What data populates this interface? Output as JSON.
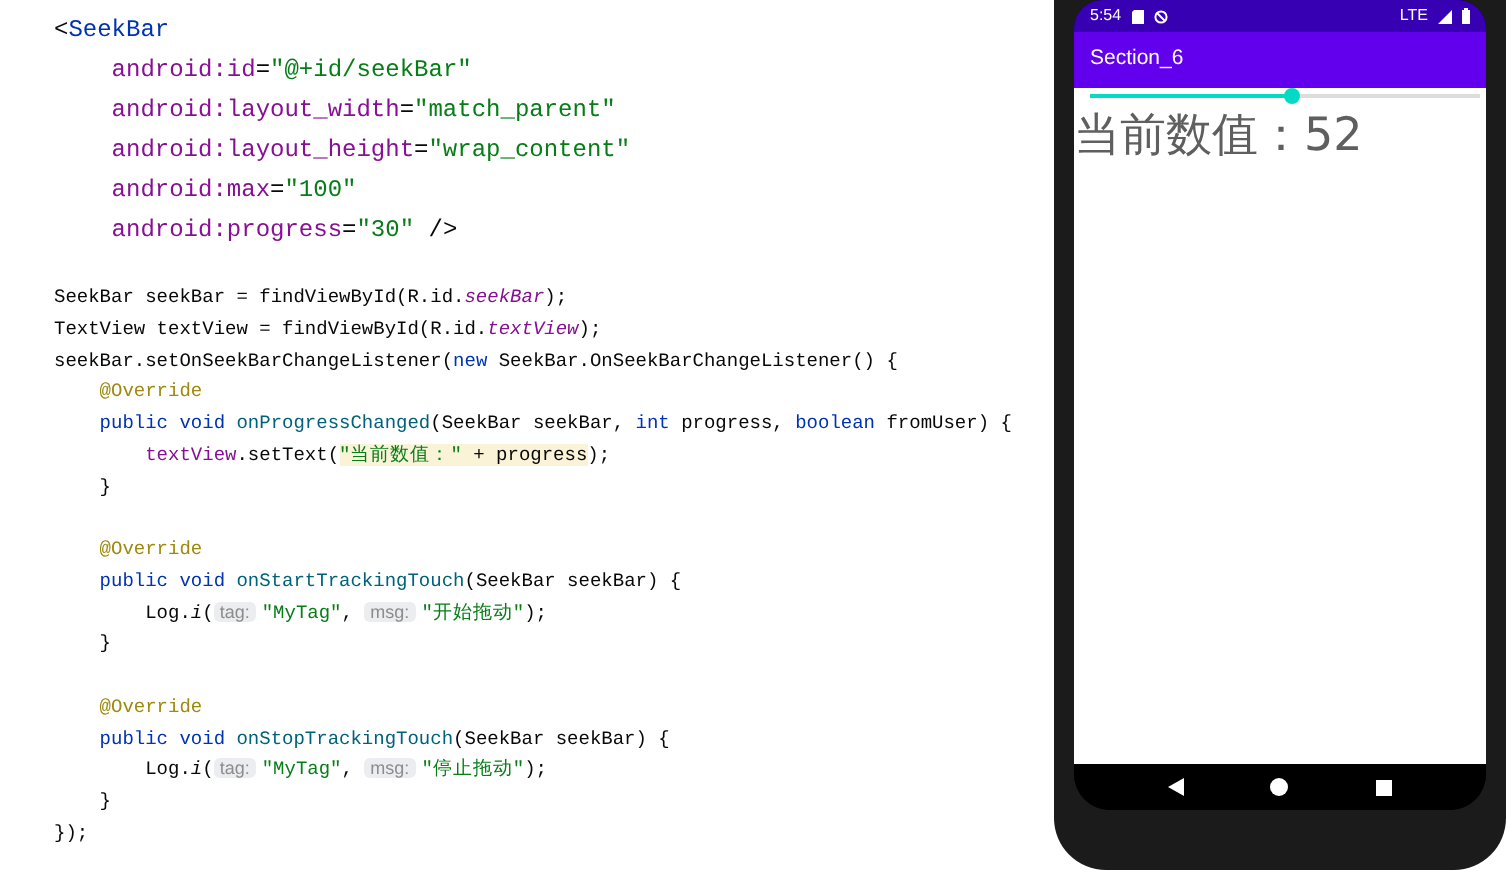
{
  "xml_code": {
    "lines": [
      {
        "kind": "code",
        "tokens": [
          {
            "kind": "plain",
            "text": "<"
          },
          {
            "kind": "tag",
            "text": "SeekBar"
          }
        ]
      },
      {
        "kind": "code",
        "tokens": [
          {
            "kind": "attr",
            "text": "    android:id"
          },
          {
            "kind": "plain",
            "text": "="
          },
          {
            "kind": "string",
            "text": "\"@+id/seekBar\""
          }
        ]
      },
      {
        "kind": "code",
        "tokens": [
          {
            "kind": "attr",
            "text": "    android:layout_width"
          },
          {
            "kind": "plain",
            "text": "="
          },
          {
            "kind": "string",
            "text": "\"match_parent\""
          }
        ]
      },
      {
        "kind": "code",
        "tokens": [
          {
            "kind": "attr",
            "text": "    android:layout_height"
          },
          {
            "kind": "plain",
            "text": "="
          },
          {
            "kind": "string",
            "text": "\"wrap_content\""
          }
        ]
      },
      {
        "kind": "code",
        "tokens": [
          {
            "kind": "attr",
            "text": "    android:max"
          },
          {
            "kind": "plain",
            "text": "="
          },
          {
            "kind": "string",
            "text": "\"100\""
          }
        ]
      },
      {
        "kind": "code",
        "tokens": [
          {
            "kind": "attr",
            "text": "    android:progress"
          },
          {
            "kind": "plain",
            "text": "="
          },
          {
            "kind": "string",
            "text": "\"30\""
          },
          {
            "kind": "plain",
            "text": " />"
          }
        ]
      }
    ]
  },
  "java_code": {
    "lines": [
      {
        "kind": "code",
        "tokens": [
          {
            "kind": "plain",
            "text": "SeekBar seekBar = findViewById(R.id."
          },
          {
            "kind": "field",
            "text": "seekBar"
          },
          {
            "kind": "plain",
            "text": ");"
          }
        ]
      },
      {
        "kind": "code",
        "tokens": [
          {
            "kind": "plain",
            "text": "TextView textView = findViewById(R.id."
          },
          {
            "kind": "field",
            "text": "textView"
          },
          {
            "kind": "plain",
            "text": ");"
          }
        ]
      },
      {
        "kind": "code",
        "tokens": [
          {
            "kind": "plain",
            "text": "seekBar.setOnSeekBarChangeListener("
          },
          {
            "kind": "keyword",
            "text": "new"
          },
          {
            "kind": "plain",
            "text": " SeekBar.OnSeekBarChangeListener() {"
          }
        ]
      },
      {
        "kind": "code",
        "tokens": [
          {
            "kind": "annotation",
            "text": "    @Override"
          }
        ]
      },
      {
        "kind": "code",
        "tokens": [
          {
            "kind": "keyword",
            "text": "    public void "
          },
          {
            "kind": "method",
            "text": "onProgressChanged"
          },
          {
            "kind": "plain",
            "text": "(SeekBar seekBar, "
          },
          {
            "kind": "keyword",
            "text": "int"
          },
          {
            "kind": "plain",
            "text": " progress, "
          },
          {
            "kind": "keyword",
            "text": "boolean"
          },
          {
            "kind": "plain",
            "text": " fromUser) {"
          }
        ]
      },
      {
        "kind": "code",
        "tokens": [
          {
            "kind": "member",
            "text": "        textView"
          },
          {
            "kind": "plain",
            "text": ".setText("
          },
          {
            "kind": "string_hl",
            "text": "\"当前数值：\""
          },
          {
            "kind": "plain_hl",
            "text": " + progress"
          },
          {
            "kind": "plain",
            "text": ");"
          }
        ]
      },
      {
        "kind": "code",
        "tokens": [
          {
            "kind": "plain",
            "text": "    }"
          }
        ]
      },
      {
        "kind": "blank"
      },
      {
        "kind": "code",
        "tokens": [
          {
            "kind": "annotation",
            "text": "    @Override"
          }
        ]
      },
      {
        "kind": "code",
        "tokens": [
          {
            "kind": "keyword",
            "text": "    public void "
          },
          {
            "kind": "method",
            "text": "onStartTrackingTouch"
          },
          {
            "kind": "plain",
            "text": "(SeekBar seekBar) {"
          }
        ]
      },
      {
        "kind": "code",
        "tokens": [
          {
            "kind": "plain",
            "text": "        Log."
          },
          {
            "kind": "static",
            "text": "i"
          },
          {
            "kind": "plain",
            "text": "("
          },
          {
            "kind": "hint",
            "text": "tag:"
          },
          {
            "kind": "string",
            "text": "\"MyTag\""
          },
          {
            "kind": "plain",
            "text": ", "
          },
          {
            "kind": "hint",
            "text": "msg:"
          },
          {
            "kind": "string",
            "text": "\"开始拖动\""
          },
          {
            "kind": "plain",
            "text": ");"
          }
        ]
      },
      {
        "kind": "code",
        "tokens": [
          {
            "kind": "plain",
            "text": "    }"
          }
        ]
      },
      {
        "kind": "blank"
      },
      {
        "kind": "code",
        "tokens": [
          {
            "kind": "annotation",
            "text": "    @Override"
          }
        ]
      },
      {
        "kind": "code",
        "tokens": [
          {
            "kind": "keyword",
            "text": "    public void "
          },
          {
            "kind": "method",
            "text": "onStopTrackingTouch"
          },
          {
            "kind": "plain",
            "text": "(SeekBar seekBar) {"
          }
        ]
      },
      {
        "kind": "code",
        "tokens": [
          {
            "kind": "plain",
            "text": "        Log."
          },
          {
            "kind": "static",
            "text": "i"
          },
          {
            "kind": "plain",
            "text": "("
          },
          {
            "kind": "hint",
            "text": "tag:"
          },
          {
            "kind": "string",
            "text": "\"MyTag\""
          },
          {
            "kind": "plain",
            "text": ", "
          },
          {
            "kind": "hint",
            "text": "msg:"
          },
          {
            "kind": "string",
            "text": "\"停止拖动\""
          },
          {
            "kind": "plain",
            "text": ");"
          }
        ]
      },
      {
        "kind": "code",
        "tokens": [
          {
            "kind": "plain",
            "text": "    }"
          }
        ]
      },
      {
        "kind": "code",
        "tokens": [
          {
            "kind": "plain",
            "text": "});"
          }
        ]
      }
    ]
  },
  "phone": {
    "status_bar": {
      "time": "5:54",
      "network": "LTE"
    },
    "app_bar": {
      "title": "Section_6"
    },
    "seekbar": {
      "level": 0.52
    },
    "value_text": "当前数值：52"
  }
}
